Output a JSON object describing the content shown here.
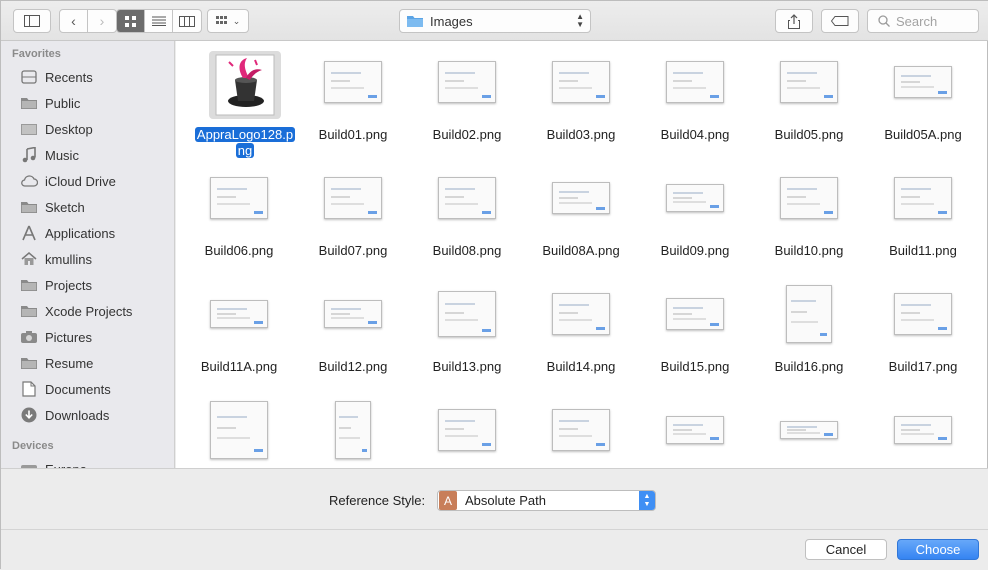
{
  "toolbar": {
    "location": "Images",
    "search_placeholder": "Search"
  },
  "sidebar": {
    "favorites_label": "Favorites",
    "favorites": [
      {
        "label": "Recents",
        "icon": "recents-icon"
      },
      {
        "label": "Public",
        "icon": "folder-icon"
      },
      {
        "label": "Desktop",
        "icon": "desktop-icon"
      },
      {
        "label": "Music",
        "icon": "music-icon"
      },
      {
        "label": "iCloud Drive",
        "icon": "cloud-icon"
      },
      {
        "label": "Sketch",
        "icon": "folder-icon"
      },
      {
        "label": "Applications",
        "icon": "applications-icon"
      },
      {
        "label": "kmullins",
        "icon": "home-icon"
      },
      {
        "label": "Projects",
        "icon": "folder-icon"
      },
      {
        "label": "Xcode Projects",
        "icon": "folder-icon"
      },
      {
        "label": "Pictures",
        "icon": "camera-icon"
      },
      {
        "label": "Resume",
        "icon": "folder-icon"
      },
      {
        "label": "Documents",
        "icon": "document-icon"
      },
      {
        "label": "Downloads",
        "icon": "download-icon"
      }
    ],
    "devices_label": "Devices",
    "devices": [
      {
        "label": "Europa",
        "icon": "disk-icon"
      }
    ]
  },
  "files": [
    {
      "name": "AppraLogo128.png",
      "name_lines": [
        "AppraLogo128.p",
        "ng"
      ],
      "selected": true
    },
    {
      "name": "Build01.png"
    },
    {
      "name": "Build02.png"
    },
    {
      "name": "Build03.png"
    },
    {
      "name": "Build04.png"
    },
    {
      "name": "Build05.png"
    },
    {
      "name": "Build05A.png"
    },
    {
      "name": "Build06.png"
    },
    {
      "name": "Build07.png"
    },
    {
      "name": "Build08.png"
    },
    {
      "name": "Build08A.png"
    },
    {
      "name": "Build09.png"
    },
    {
      "name": "Build10.png"
    },
    {
      "name": "Build11.png"
    },
    {
      "name": "Build11A.png"
    },
    {
      "name": "Build12.png"
    },
    {
      "name": "Build13.png"
    },
    {
      "name": "Build14.png"
    },
    {
      "name": "Build15.png"
    },
    {
      "name": "Build16.png"
    },
    {
      "name": "Build17.png"
    },
    {
      "name": ""
    },
    {
      "name": ""
    },
    {
      "name": ""
    },
    {
      "name": ""
    },
    {
      "name": ""
    },
    {
      "name": ""
    },
    {
      "name": ""
    }
  ],
  "footer": {
    "reference_label": "Reference Style:",
    "reference_icon_letter": "A",
    "reference_value": "Absolute Path",
    "cancel_label": "Cancel",
    "choose_label": "Choose"
  },
  "colors": {
    "accent": "#3584f2",
    "selection": "#1a6ed8"
  }
}
